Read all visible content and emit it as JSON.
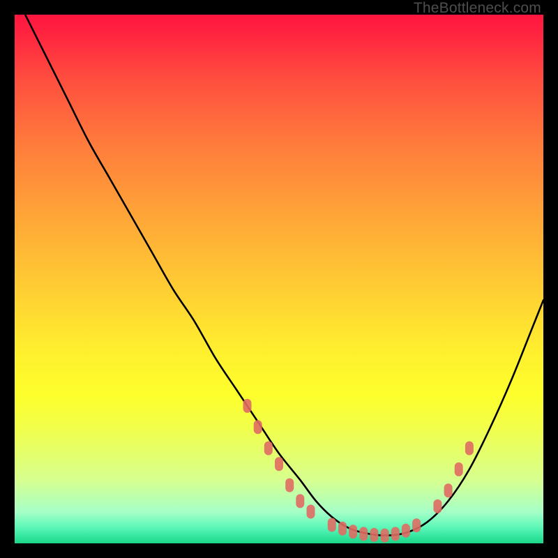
{
  "watermark": "TheBottleneck.com",
  "chart_data": {
    "type": "line",
    "title": "",
    "xlabel": "",
    "ylabel": "",
    "xlim": [
      0,
      100
    ],
    "ylim": [
      0,
      100
    ],
    "series": [
      {
        "name": "bottleneck-curve",
        "color": "#000000",
        "x": [
          2,
          6,
          10,
          14,
          18,
          22,
          26,
          30,
          34,
          38,
          42,
          46,
          50,
          54,
          57,
          60,
          63,
          66,
          70,
          74,
          78,
          82,
          86,
          90,
          94,
          98,
          100
        ],
        "y": [
          100,
          92,
          84,
          76,
          69,
          62,
          55,
          48,
          42,
          35,
          29,
          23,
          17,
          12,
          8,
          5,
          3,
          2,
          1.5,
          2,
          4,
          8,
          14,
          22,
          31,
          41,
          46
        ]
      },
      {
        "name": "highlight-dots-left",
        "color": "#e06b63",
        "x": [
          44,
          46,
          48,
          50,
          52,
          54,
          56
        ],
        "y": [
          26,
          22,
          18,
          15,
          11,
          8,
          6
        ]
      },
      {
        "name": "highlight-dots-bottom",
        "color": "#e06b63",
        "x": [
          60,
          62,
          64,
          66,
          68,
          70,
          72,
          74,
          76
        ],
        "y": [
          3.5,
          2.8,
          2.2,
          1.8,
          1.6,
          1.5,
          1.8,
          2.4,
          3.4
        ]
      },
      {
        "name": "highlight-dots-right",
        "color": "#e06b63",
        "x": [
          80,
          82,
          84,
          86
        ],
        "y": [
          7,
          10,
          14,
          18
        ]
      }
    ]
  }
}
